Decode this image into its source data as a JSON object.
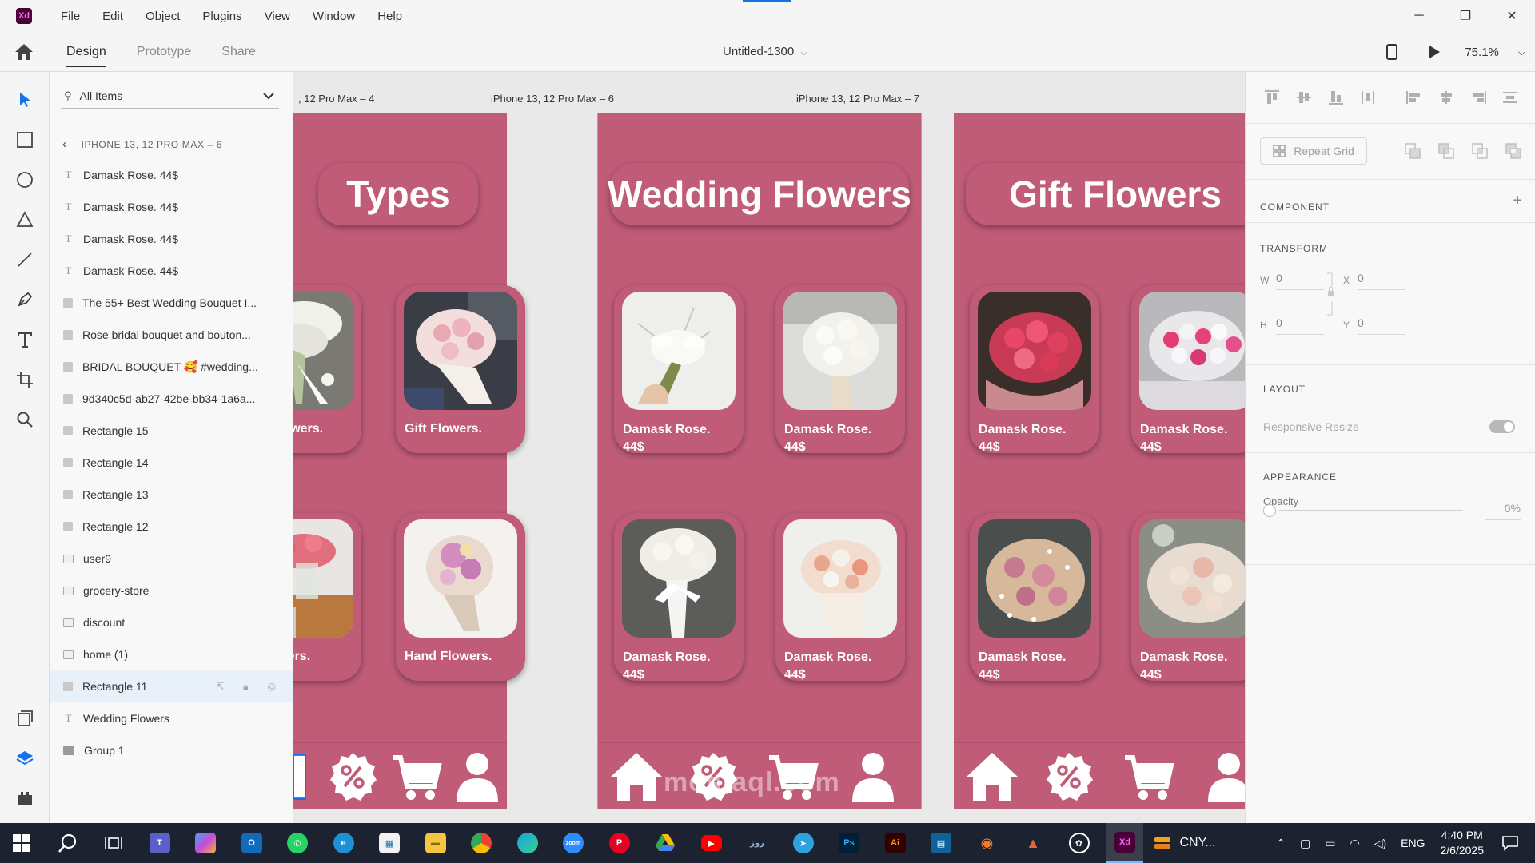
{
  "app": {
    "logo_text": "Xd",
    "menu": [
      "File",
      "Edit",
      "Object",
      "Plugins",
      "View",
      "Window",
      "Help"
    ],
    "window_controls": [
      "─",
      "❐",
      "✕"
    ]
  },
  "toolbar": {
    "tabs": [
      "Design",
      "Prototype",
      "Share"
    ],
    "active_tab": "Design",
    "document_title": "Untitled-1300",
    "zoom": "75.1%"
  },
  "layers_panel": {
    "search_label": "All Items",
    "breadcrumb": "IPHONE 13, 12 PRO MAX – 6",
    "items": [
      {
        "kind": "text",
        "label": "Damask Rose. 44$"
      },
      {
        "kind": "text",
        "label": "Damask Rose. 44$"
      },
      {
        "kind": "text",
        "label": "Damask Rose. 44$"
      },
      {
        "kind": "text",
        "label": "Damask Rose. 44$"
      },
      {
        "kind": "rect",
        "label": "The 55+ Best Wedding Bouquet I..."
      },
      {
        "kind": "rect",
        "label": "Rose bridal bouquet and bouton..."
      },
      {
        "kind": "rect",
        "label": "BRIDAL BOUQUET 🥰 #wedding..."
      },
      {
        "kind": "rect",
        "label": "9d340c5d-ab27-42be-bb34-1a6a..."
      },
      {
        "kind": "rect",
        "label": "Rectangle 15"
      },
      {
        "kind": "rect",
        "label": "Rectangle 14"
      },
      {
        "kind": "rect",
        "label": "Rectangle 13"
      },
      {
        "kind": "rect",
        "label": "Rectangle 12"
      },
      {
        "kind": "image",
        "label": "user9"
      },
      {
        "kind": "image",
        "label": "grocery-store"
      },
      {
        "kind": "image",
        "label": "discount"
      },
      {
        "kind": "image",
        "label": "home (1)"
      },
      {
        "kind": "rect",
        "label": "Rectangle 11",
        "highlighted": true
      },
      {
        "kind": "text",
        "label": "Wedding Flowers"
      },
      {
        "kind": "folder",
        "label": "Group 1"
      }
    ]
  },
  "artboards": [
    {
      "label": ", 12 Pro Max – 4",
      "title": "Types",
      "cards": [
        {
          "name": "ding Flowers.",
          "price": "",
          "photo": "white tulip bouquet"
        },
        {
          "name": "Gift Flowers.",
          "price": "",
          "photo": "pink roses bouquet"
        },
        {
          "name": "ce Flowers.",
          "price": "",
          "photo": "pink tulips vase"
        },
        {
          "name": "Hand Flowers.",
          "price": "",
          "photo": "pink dahlia bouquet"
        }
      ]
    },
    {
      "label": "iPhone 13, 12 Pro Max – 6",
      "title": "Wedding Flowers",
      "cards": [
        {
          "name": "Damask Rose.",
          "price": "44$",
          "photo": "white calla lilies"
        },
        {
          "name": "Damask Rose.",
          "price": "44$",
          "photo": "white rose bouquet"
        },
        {
          "name": "Damask Rose.",
          "price": "44$",
          "photo": "white roses ribbon"
        },
        {
          "name": "Damask Rose.",
          "price": "44$",
          "photo": "peach rose bouquet"
        }
      ]
    },
    {
      "label": "iPhone 13, 12 Pro Max – 7",
      "title": "Gift Flowers",
      "cards": [
        {
          "name": "Damask Rose.",
          "price": "44$",
          "photo": "red roses bouquet"
        },
        {
          "name": "Damask Rose.",
          "price": "44$",
          "photo": "pink white tulips"
        },
        {
          "name": "Damask Rose.",
          "price": "44$",
          "photo": "pink roses gypsophila"
        },
        {
          "name": "Damask Rose.",
          "price": "44$",
          "photo": "cream roses bouquet"
        }
      ]
    }
  ],
  "properties": {
    "repeat_grid": "Repeat Grid",
    "component": "COMPONENT",
    "transform": "TRANSFORM",
    "w_label": "W",
    "w_value": "0",
    "h_label": "H",
    "h_value": "0",
    "x_label": "X",
    "x_value": "0",
    "y_label": "Y",
    "y_value": "0",
    "layout": "LAYOUT",
    "responsive_resize": "Responsive Resize",
    "appearance": "APPEARANCE",
    "opacity_label": "Opacity",
    "opacity_value": "0%"
  },
  "taskbar": {
    "currency": "CNY...",
    "language": "ENG",
    "time": "4:40 PM",
    "date": "2/6/2025"
  },
  "watermark": "mostaql.com",
  "colors": {
    "artboard_pink": "#c05c78",
    "xd_purple": "#470137",
    "xd_magenta": "#ff61f6",
    "taskbar": "#1c2230"
  }
}
